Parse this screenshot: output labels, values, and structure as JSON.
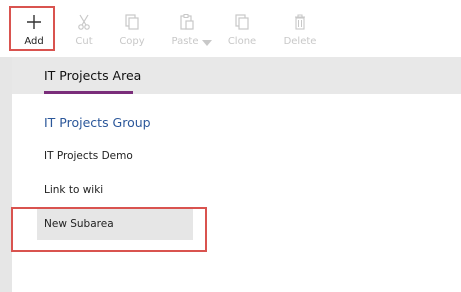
{
  "toolbar": {
    "items": [
      {
        "label": "Add",
        "icon": "plus-icon",
        "enabled": true
      },
      {
        "label": "Cut",
        "icon": "scissors-icon",
        "enabled": false
      },
      {
        "label": "Copy",
        "icon": "copy-icon",
        "enabled": false
      },
      {
        "label": "Paste",
        "icon": "paste-icon",
        "enabled": false
      },
      {
        "label": "Clone",
        "icon": "clone-icon",
        "enabled": false
      },
      {
        "label": "Delete",
        "icon": "trash-icon",
        "enabled": false
      }
    ]
  },
  "area": {
    "title": "IT Projects Area"
  },
  "group": {
    "title": "IT Projects Group",
    "items": [
      "IT Projects Demo",
      "Link to wiki",
      "New Subarea"
    ]
  },
  "colors": {
    "highlight": "#d9534f",
    "accent": "#7a2d7a",
    "group_title": "#2b579a"
  }
}
